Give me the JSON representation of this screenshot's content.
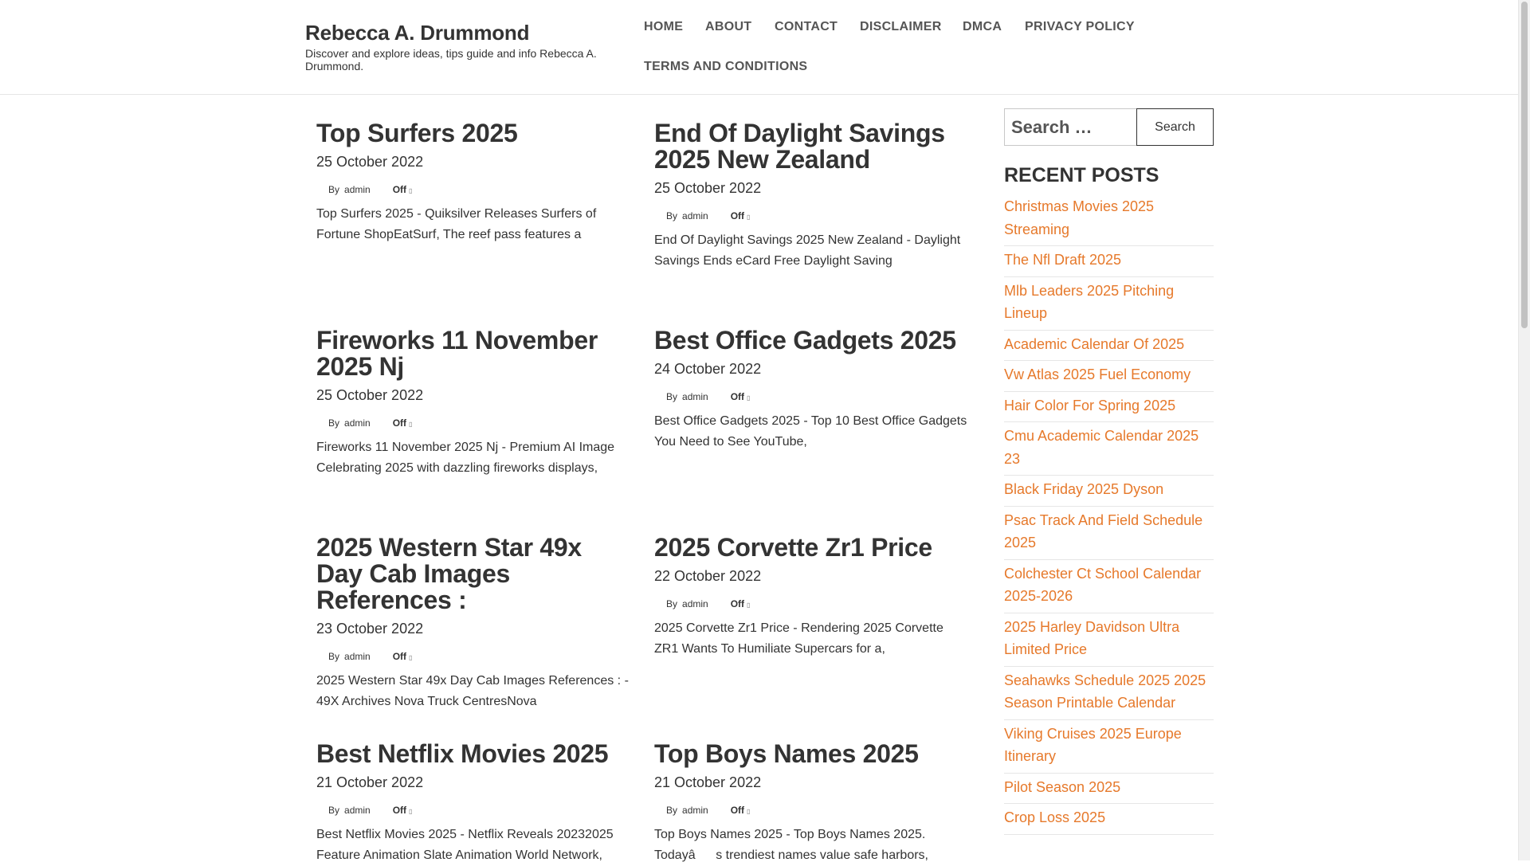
{
  "site": {
    "title": "Rebecca A. Drummond",
    "description": "Discover and explore ideas, tips guide and info Rebecca A. Drummond."
  },
  "nav": [
    {
      "label": "HOME"
    },
    {
      "label": "ABOUT"
    },
    {
      "label": "CONTACT"
    },
    {
      "label": "DISCLAIMER"
    },
    {
      "label": "DMCA"
    },
    {
      "label": "PRIVACY POLICY"
    },
    {
      "label": "TERMS AND CONDITIONS"
    }
  ],
  "posts": [
    {
      "title": "Top Surfers 2025",
      "date": "25 October 2022",
      "by": "By",
      "author": "admin",
      "comments": "Off",
      "excerpt": "Top Surfers 2025 - Quiksilver Releases Surfers of Fortune ShopEatSurf, The reef pass features a"
    },
    {
      "title": "End Of Daylight Savings 2025 New Zealand",
      "date": "25 October 2022",
      "by": "By",
      "author": "admin",
      "comments": "Off",
      "excerpt": "End Of Daylight Savings 2025 New Zealand - Daylight Savings Ends eCard Free Daylight Saving"
    },
    {
      "title": "Fireworks 11 November 2025 Nj",
      "date": "25 October 2022",
      "by": "By",
      "author": "admin",
      "comments": "Off",
      "excerpt": "Fireworks 11 November 2025 Nj - Premium AI Image Celebrating 2025 with dazzling fireworks displays,"
    },
    {
      "title": "Best Office Gadgets 2025",
      "date": "24 October 2022",
      "by": "By",
      "author": "admin",
      "comments": "Off",
      "excerpt": "Best Office Gadgets 2025 - Top 10 Best Office Gadgets You Need to See YouTube,"
    },
    {
      "title": "2025 Western Star 49x Day Cab Images References :",
      "date": "23 October 2022",
      "by": "By",
      "author": "admin",
      "comments": "Off",
      "excerpt": "2025 Western Star 49x Day Cab Images References : - 49X Archives Nova Truck CentresNova"
    },
    {
      "title": "2025 Corvette Zr1 Price",
      "date": "22 October 2022",
      "by": "By",
      "author": "admin",
      "comments": "Off",
      "excerpt": "2025 Corvette Zr1 Price - Rendering 2025 Corvette ZR1 Wants To Humiliate Supercars for a,"
    },
    {
      "title": "Best Netflix Movies 2025",
      "date": "21 October 2022",
      "by": "By",
      "author": "admin",
      "comments": "Off",
      "excerpt": "Best Netflix Movies 2025 - Netflix Reveals 20232025 Feature Animation Slate Animation World Network,"
    },
    {
      "title": "Top Boys Names 2025",
      "date": "21 October 2022",
      "by": "By",
      "author": "admin",
      "comments": "Off",
      "excerpt": "Top Boys Names 2025 - Top Boys Names 2025. Todayâs trendiest names value safe harbors,"
    }
  ],
  "search": {
    "placeholder": "Search …",
    "button_label": "Search"
  },
  "sidebar": {
    "recent_title": "RECENT POSTS",
    "recent_posts": [
      "Christmas Movies 2025 Streaming",
      "The Nfl Draft 2025",
      "Mlb Leaders 2025 Pitching Lineup",
      "Academic Calendar Of 2025",
      "Vw Atlas 2025 Fuel Economy",
      "Hair Color For Spring 2025",
      "Cmu Academic Calendar 2025 23",
      "Black Friday 2025 Dyson",
      "Psac Track And Field Schedule 2025",
      "Colchester Ct School Calendar 2025-2026",
      "2025 Harley Davidson Ultra Limited Price",
      "Seahawks Schedule 2025 2025 Season Printable Calendar",
      "Viking Cruises 2025 Europe Itinerary",
      "Pilot Season 2025",
      "Crop Loss 2025"
    ]
  },
  "colors": {
    "link": "#e6792b",
    "text": "#333333",
    "nav": "#555555",
    "border": "#e6e6e6"
  },
  "icons": {
    "comments": "comment-icon"
  }
}
